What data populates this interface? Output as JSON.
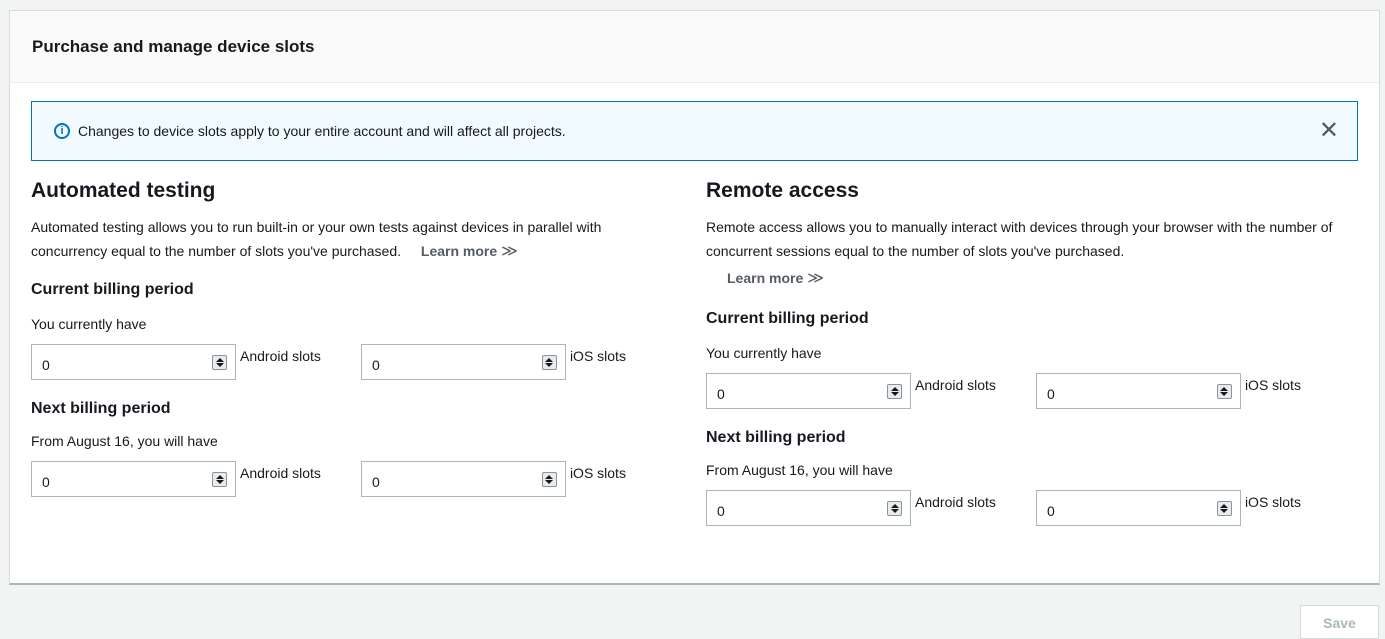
{
  "panel": {
    "title": "Purchase and manage device slots"
  },
  "alert": {
    "icon": "info-icon",
    "text": "Changes to device slots apply to your entire account and will affect all projects.",
    "close_icon": "close-icon"
  },
  "automated": {
    "title": "Automated testing",
    "description": "Automated testing allows you to run built-in or your own tests against devices in parallel with concurrency equal to the number of slots you've purchased.",
    "learn_more": "Learn more",
    "current": {
      "heading": "Current billing period",
      "note": "You currently have",
      "android_value": "0",
      "android_label": "Android slots",
      "ios_value": "0",
      "ios_label": "iOS slots"
    },
    "next": {
      "heading": "Next billing period",
      "note": "From August 16, you will have",
      "android_value": "0",
      "android_label": "Android slots",
      "ios_value": "0",
      "ios_label": "iOS slots"
    }
  },
  "remote": {
    "title": "Remote access",
    "description": "Remote access allows you to manually interact with devices through your browser with the number of concurrent sessions equal to the number of slots you've purchased.",
    "learn_more": "Learn more",
    "current": {
      "heading": "Current billing period",
      "note": "You currently have",
      "android_value": "0",
      "android_label": "Android slots",
      "ios_value": "0",
      "ios_label": "iOS slots"
    },
    "next": {
      "heading": "Next billing period",
      "note": "From August 16, you will have",
      "android_value": "0",
      "android_label": "Android slots",
      "ios_value": "0",
      "ios_label": "iOS slots"
    }
  },
  "footer": {
    "save_label": "Save"
  },
  "colors": {
    "accent": "#0073bb",
    "alert_bg": "#f1faff",
    "page_bg": "#f2f3f3"
  }
}
